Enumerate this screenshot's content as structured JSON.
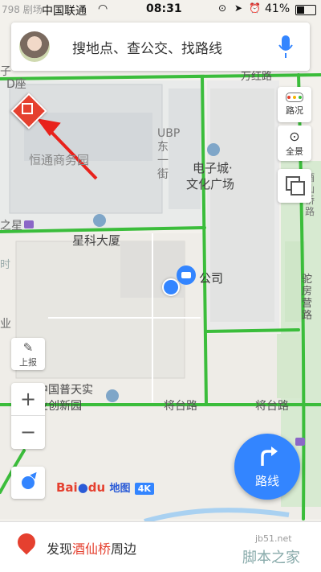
{
  "status_bar": {
    "carrier": "中国联通",
    "time": "08:31",
    "battery": "41%",
    "top_left_partial": "798 剧场"
  },
  "search": {
    "placeholder": "搜地点、查公交、找路线"
  },
  "right_controls": {
    "traffic_label": "路况",
    "panorama_label": "全景"
  },
  "left_controls": {
    "report_label": "上报",
    "zoom_in": "+",
    "zoom_out": "−"
  },
  "route_button": {
    "label": "路线"
  },
  "map_labels": {
    "top_road": "万红路",
    "d_block": "D座",
    "top_left_fragment": "子",
    "hengtong_park": "恒通商务园",
    "ubp": "UBP东一街",
    "electronic_city": "电子城·",
    "culture_plaza": "文化广场",
    "star_fragment": "之星",
    "kexing_building": "星科大厦",
    "company": "公司",
    "jiangtai_road_1": "将台路",
    "jiangtai_road_2": "将台路",
    "putian_line1": "中国普天实",
    "putian_line2": "业创新园",
    "ye_fragment": "业",
    "tuo_fragment": "时",
    "tuofang_road": "驼房营路",
    "side_road": "酒仙桥路"
  },
  "logo": {
    "baidu": "Bai",
    "du": "du",
    "ditu": "地图",
    "version": "4K"
  },
  "bottom_bar": {
    "prefix": "发现",
    "place": "酒仙桥",
    "suffix": "周边",
    "watermark_site": "jb51.net",
    "watermark_name": "脚本之家"
  },
  "colors": {
    "accent_blue": "#3385ff",
    "road_green": "#3bbd3b",
    "gift_red": "#e5402f",
    "annotation_arrow": "#e8221c"
  }
}
